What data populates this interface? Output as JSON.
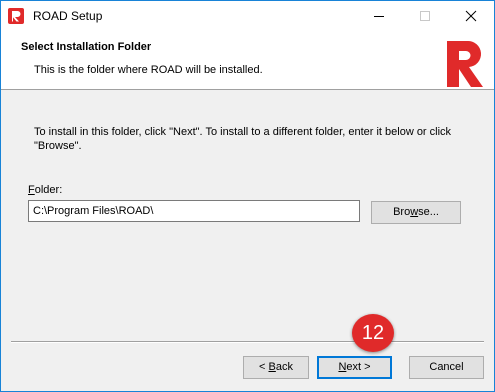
{
  "window": {
    "title": "ROAD Setup",
    "icons": {
      "app": "road-logo-icon",
      "minimize": "minimize-icon",
      "maximize": "maximize-icon",
      "close": "close-icon"
    }
  },
  "header": {
    "title": "Select Installation Folder",
    "subtitle": "This is the folder where ROAD will be installed.",
    "logo": "road-logo",
    "logo_color": "#e02a2a"
  },
  "body": {
    "instructions": "To install in this folder, click \"Next\". To install to a different folder, enter it below or click \"Browse\".",
    "folder_label_accel": "F",
    "folder_label_rest": "older:",
    "folder_value": "C:\\Program Files\\ROAD\\",
    "browse_accel": "w",
    "browse_pre": "Bro",
    "browse_post": "se..."
  },
  "footer": {
    "back_pre": "< ",
    "back_accel": "B",
    "back_post": "ack",
    "next_accel": "N",
    "next_post": "ext >",
    "cancel_label": "Cancel"
  },
  "annotation": {
    "step_number": "12",
    "color": "#e02a2a"
  }
}
